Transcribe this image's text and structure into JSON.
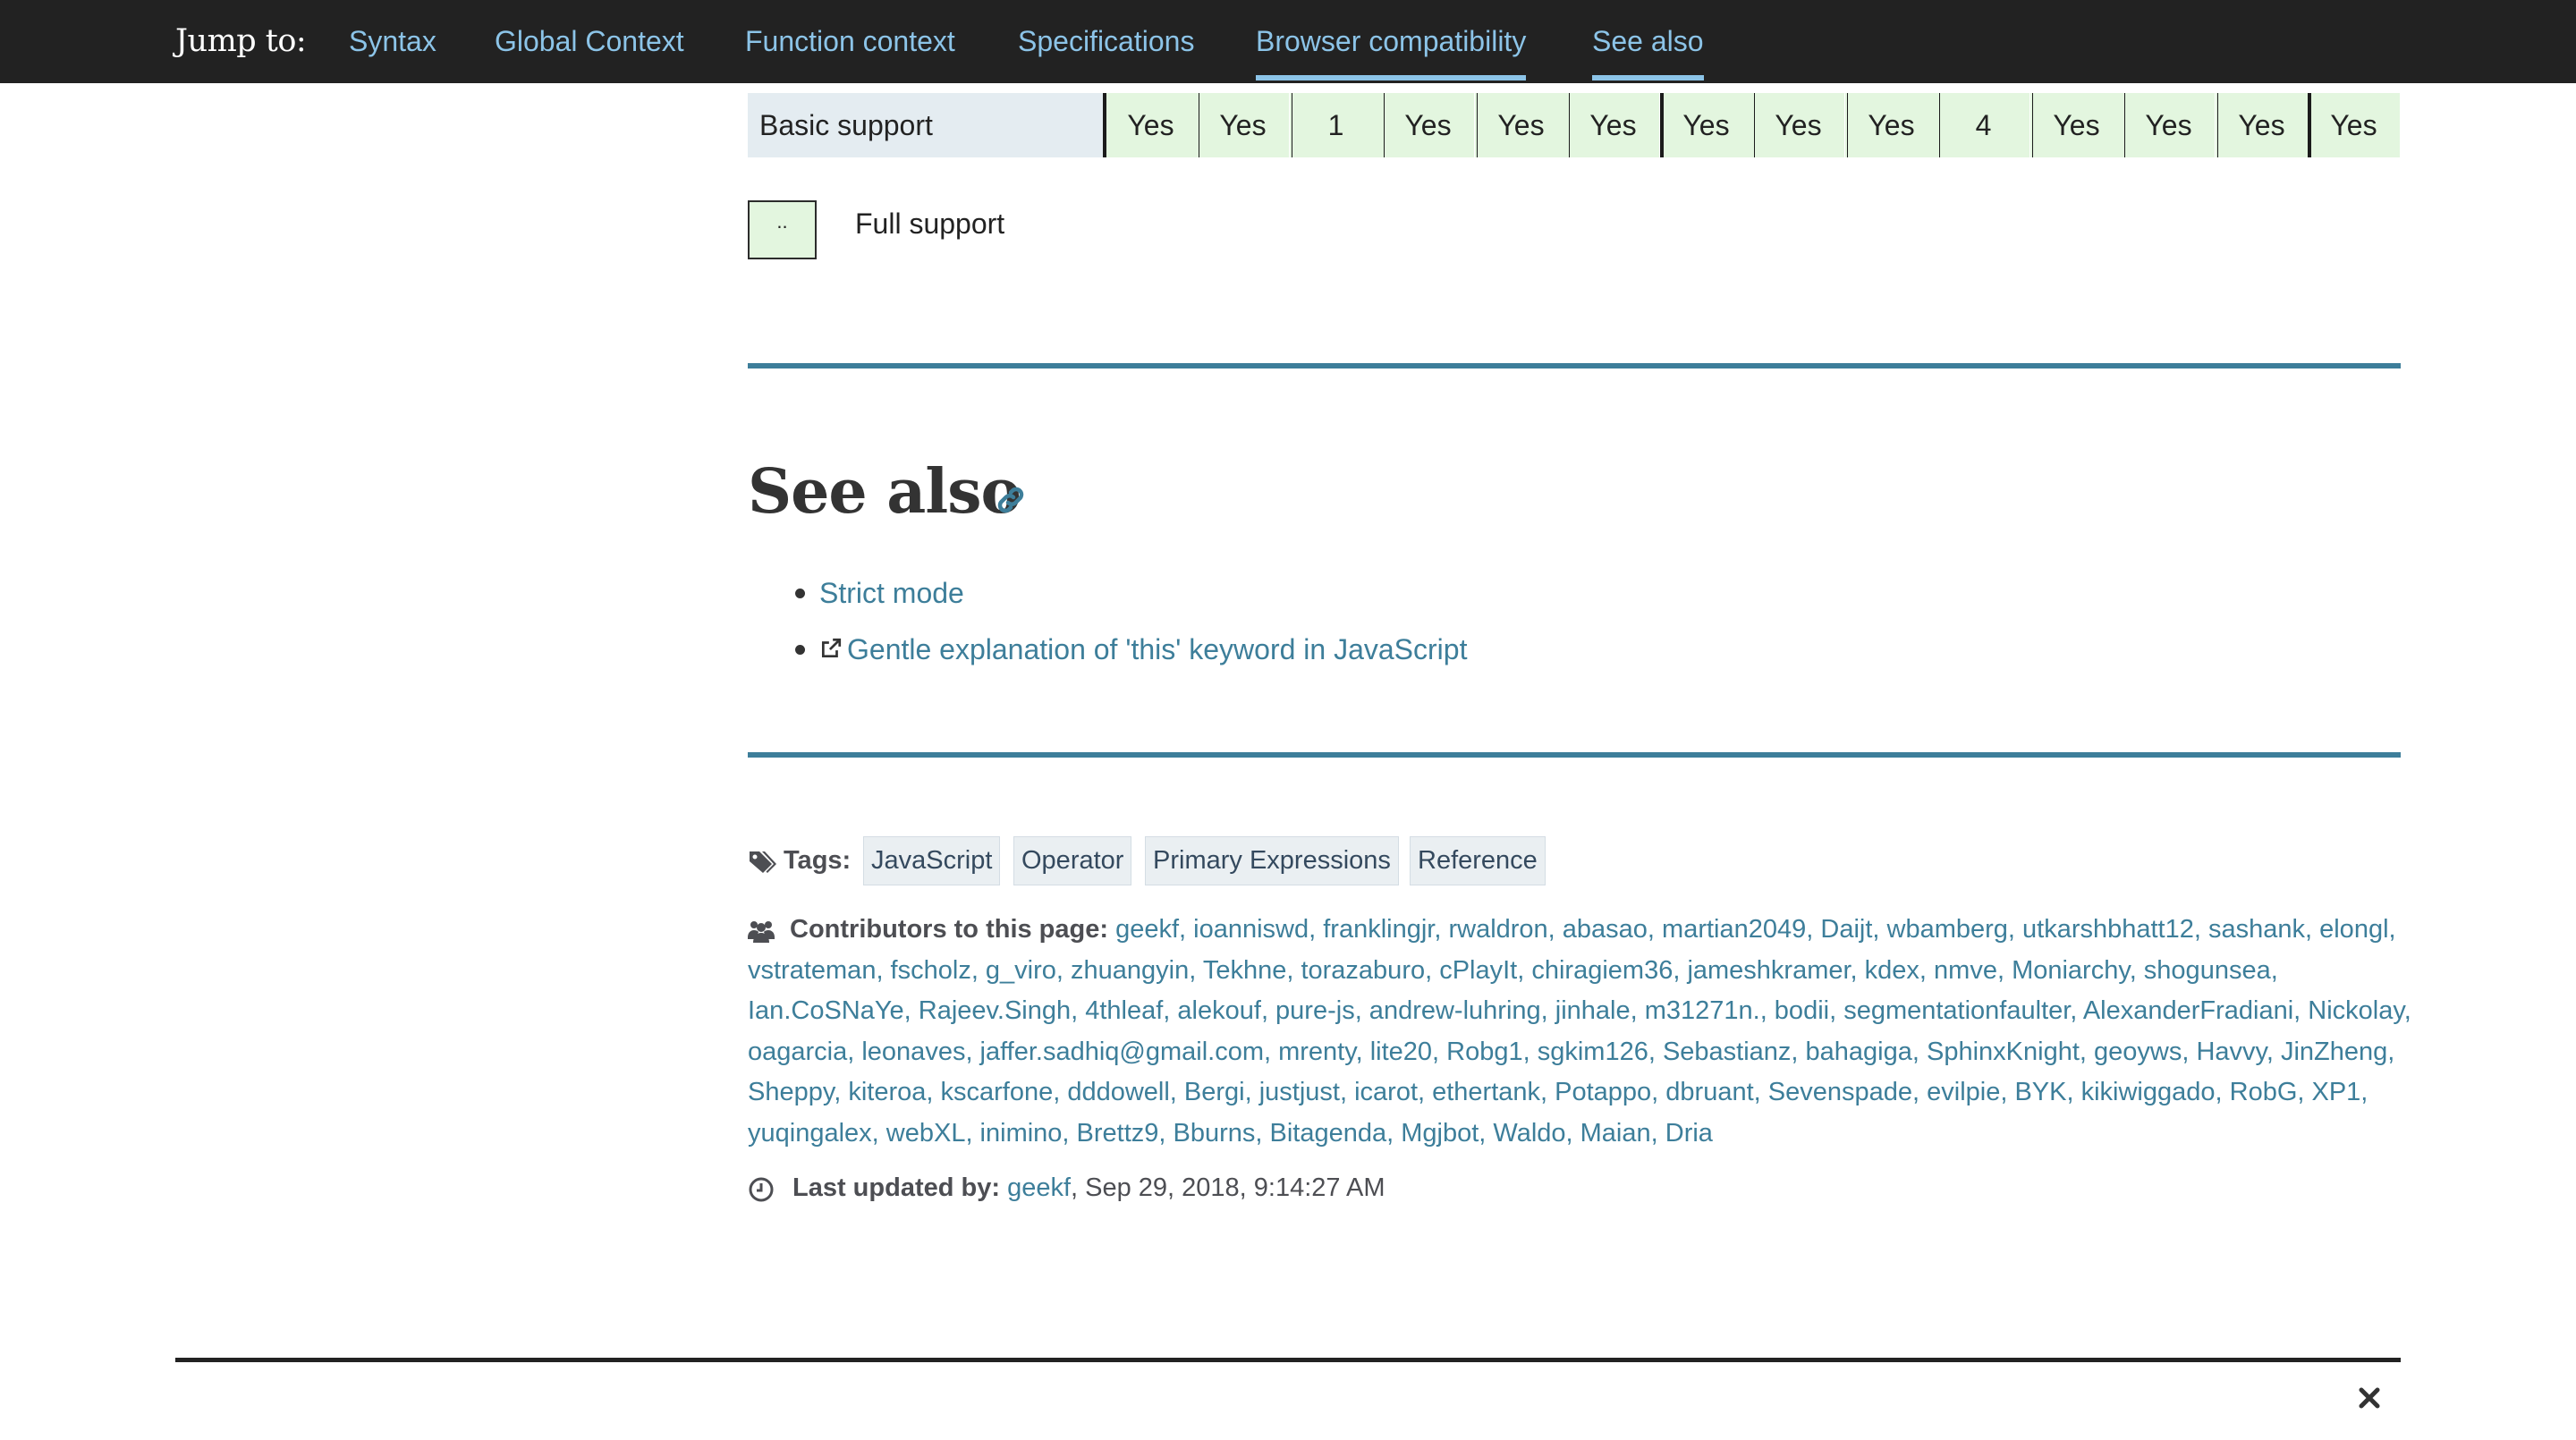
{
  "jump_to": {
    "label": "Jump to:",
    "links": [
      "Syntax",
      "Global Context",
      "Function context",
      "Specifications",
      "Browser compatibility",
      "See also"
    ]
  },
  "compat": {
    "feature": "Basic support",
    "values": [
      "Yes",
      "Yes",
      "1",
      "Yes",
      "Yes",
      "Yes",
      "Yes",
      "Yes",
      "Yes",
      "4",
      "Yes",
      "Yes",
      "Yes",
      "Yes"
    ]
  },
  "legend": {
    "marker": "..",
    "label": "Full support"
  },
  "see_also": {
    "title": "See also",
    "links": [
      "Strict mode",
      "Gentle explanation of 'this' keyword in JavaScript"
    ]
  },
  "tags": {
    "label": "Tags:",
    "items": [
      "JavaScript",
      "Operator",
      "Primary Expressions",
      "Reference"
    ]
  },
  "contributors": {
    "label": "Contributors to this page:",
    "lines": [
      "geekf, ioanniswd, franklingjr, rwaldron, abasao, martian2049, Daijt, wbamberg, utkarshbhatt12, sashank, elongl,",
      "vstrateman, fscholz, g_viro, zhuangyin, Tekhne, torazaburo, cPlayIt, chiragiem36, jameshkramer, kdex, nmve, Moniarchy, shogunsea,",
      "Ian.CoSNaYe, Rajeev.Singh, 4thleaf, alekouf, pure-js, andrew-luhring, jinhale, m31271n., bodii, segmentationfaulter, AlexanderFradiani, Nickolay,",
      "oagarcia, leonaves, jaffer.sadhiq@gmail.com, mrenty, lite20, Robg1, sgkim126, Sebastianz, bahagiga, SphinxKnight, geoyws, Havvy, JinZheng,",
      "Sheppy, kiteroa, kscarfone, dddowell, Bergi, justjust, icarot, ethertank, Potappo, dbruant, Sevenspade, evilpie, BYK, kikiwiggado, RobG, XP1,",
      "yuqingalex, webXL, inimino, Brettz9, Bburns, Bitagenda, Mgjbot, Waldo, Maian, Dria"
    ]
  },
  "last_updated": {
    "label": "Last updated by:",
    "author": "geekf",
    "date": ", Sep 29, 2018, 9:14:27 AM"
  },
  "colors": {
    "link": "#3d7e9a",
    "jump_link": "#8cc4e8",
    "support_cell": "#e3f6df",
    "header_cell": "#e4ecf1",
    "topbar": "#222222"
  }
}
